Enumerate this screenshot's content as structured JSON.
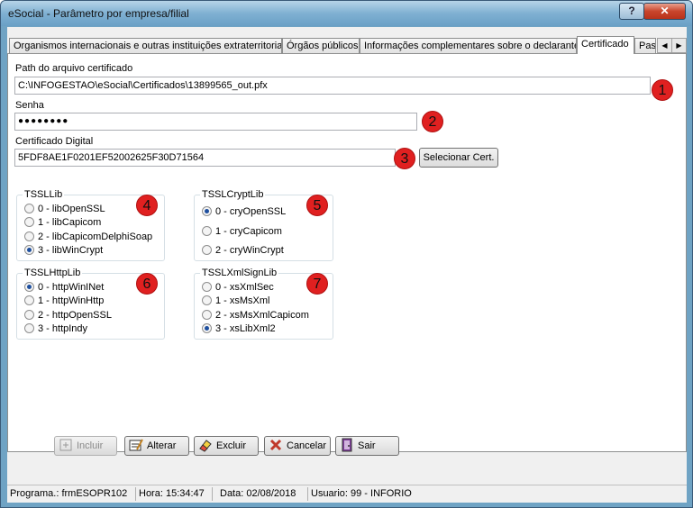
{
  "window": {
    "title": "eSocial - Parâmetro por empresa/filial",
    "help_label": "?",
    "close_label": "✕"
  },
  "tabs": [
    {
      "label": "Organismos internacionais e outras instituições extraterritoriais"
    },
    {
      "label": "Órgãos públicos"
    },
    {
      "label": "Informações complementares sobre o declarante"
    },
    {
      "label": "Certificado",
      "active": true
    },
    {
      "label": "Pas"
    }
  ],
  "certificate": {
    "path_label": "Path do arquivo certificado",
    "path_value": "C:\\INFOGESTAO\\eSocial\\Certificados\\13899565_out.pfx",
    "password_label": "Senha",
    "password_value": "●●●●●●●●",
    "digital_label": "Certificado Digital",
    "digital_value": "5FDF8AE1F0201EF52002625F30D71564",
    "select_button": "Selecionar Cert."
  },
  "markers": [
    "1",
    "2",
    "3",
    "4",
    "5",
    "6",
    "7"
  ],
  "groups": {
    "ssllib": {
      "title": "TSSLLib",
      "options": [
        "0 - libOpenSSL",
        "1 - libCapicom",
        "2 - libCapicomDelphiSoap",
        "3 - libWinCrypt"
      ],
      "selected": 3
    },
    "cryptlib": {
      "title": "TSSLCryptLib",
      "options": [
        "0 - cryOpenSSL",
        "1 - cryCapicom",
        "2 - cryWinCrypt"
      ],
      "selected": 0
    },
    "httplib": {
      "title": "TSSLHttpLib",
      "options": [
        "0 - httpWinINet",
        "1 - httpWinHttp",
        "2 - httpOpenSSL",
        "3 - httpIndy"
      ],
      "selected": 0
    },
    "xmlsignlib": {
      "title": "TSSLXmlSignLib",
      "options": [
        "0 - xsXmlSec",
        "1 - xsMsXml",
        "2 - xsMsXmlCapicom",
        "3 - xsLibXml2"
      ],
      "selected": 3
    }
  },
  "buttons": {
    "incluir": "Incluir",
    "alterar": "Alterar",
    "excluir": "Excluir",
    "cancelar": "Cancelar",
    "sair": "Sair"
  },
  "status": {
    "programa": "Programa.: frmESOPR102",
    "hora": "Hora: 15:34:47",
    "data": "Data: 02/08/2018",
    "usuario": "Usuario: 99 - INFORIO"
  },
  "colors": {
    "marker": "#e02020",
    "radio_checked": "#1e4f9e",
    "close_button": "#c9452c"
  }
}
